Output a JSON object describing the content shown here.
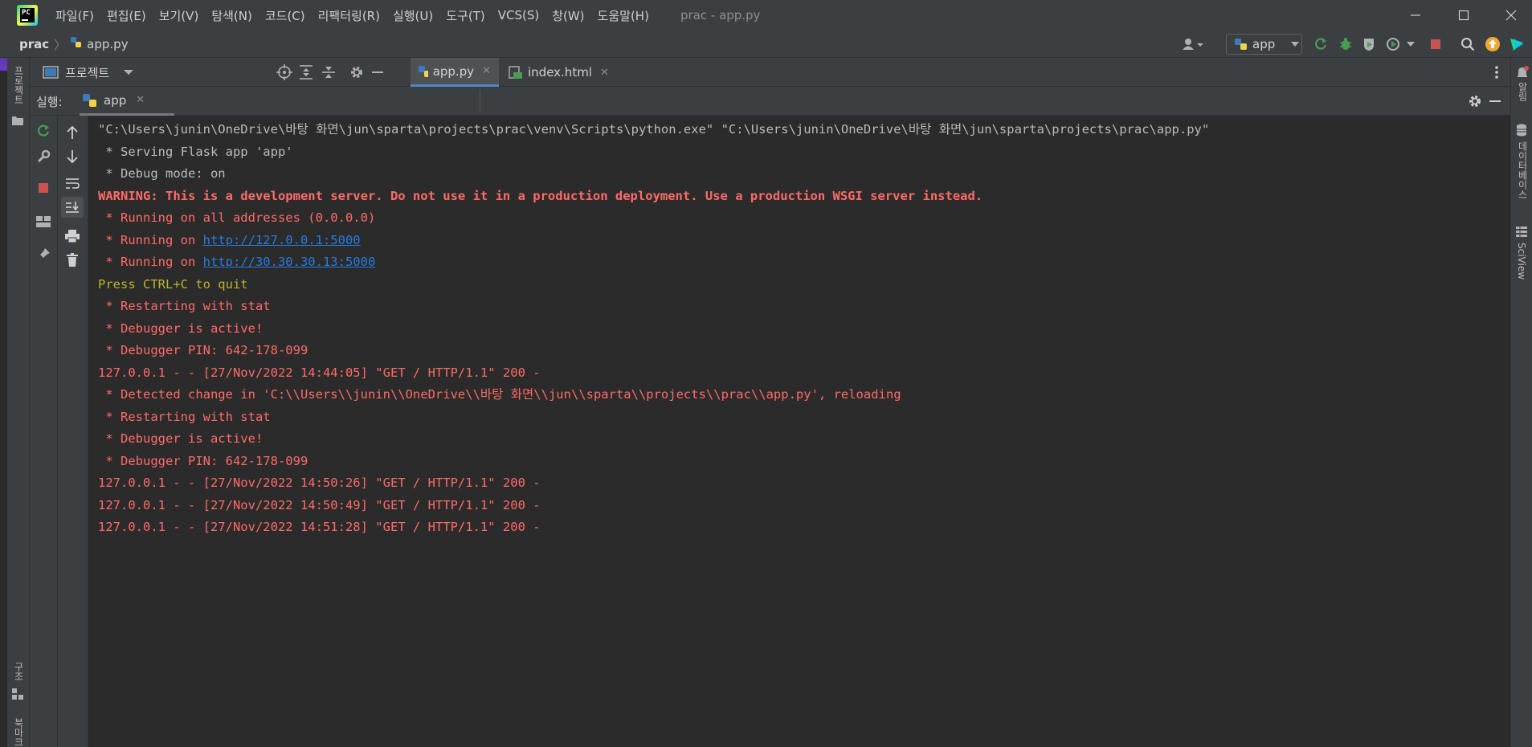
{
  "titlebar": {
    "menus": [
      "파일(F)",
      "편집(E)",
      "보기(V)",
      "탐색(N)",
      "코드(C)",
      "리팩터링(R)",
      "실행(U)",
      "도구(T)",
      "VCS(S)",
      "창(W)",
      "도움말(H)"
    ],
    "window_title": "prac - app.py",
    "logo_text": "PC"
  },
  "navbar": {
    "project": "prac",
    "file": "app.py",
    "run_config": "app"
  },
  "left_strip": {
    "project_label": "프로젝트",
    "structure_label": "구조",
    "bookmarks_label": "북마크"
  },
  "project_panel": {
    "label": "프로젝트"
  },
  "editor_tabs": [
    {
      "label": "app.py",
      "active": true
    },
    {
      "label": "index.html",
      "active": false
    }
  ],
  "run_panel": {
    "label": "실행:",
    "tab": "app"
  },
  "right_strip": {
    "notifications": "알림",
    "database": "데이터베이스",
    "sciview": "SciView"
  },
  "console": {
    "cmd": "\"C:\\Users\\junin\\OneDrive\\바탕 화면\\jun\\sparta\\projects\\prac\\venv\\Scripts\\python.exe\" \"C:\\Users\\junin\\OneDrive\\바탕 화면\\jun\\sparta\\projects\\prac\\app.py\"",
    "serving": " * Serving Flask app 'app'",
    "debug_mode": " * Debug mode: on",
    "warning": "WARNING: This is a development server. Do not use it in a production deployment. Use a production WSGI server instead.",
    "running_all": " * Running on all addresses (0.0.0.0)",
    "running_prefix": " * Running on ",
    "url_local": "http://127.0.0.1:5000",
    "url_lan": "http://30.30.30.13:5000",
    "quit": "Press CTRL+C to quit",
    "restart_1": " * Restarting with stat",
    "active_1": " * Debugger is active!",
    "pin_1": " * Debugger PIN: 642-178-099",
    "req_1": "127.0.0.1 - - [27/Nov/2022 14:44:05] \"GET / HTTP/1.1\" 200 -",
    "change": " * Detected change in 'C:\\\\Users\\\\junin\\\\OneDrive\\\\바탕 화면\\\\jun\\\\sparta\\\\projects\\\\prac\\\\app.py', reloading",
    "restart_2": " * Restarting with stat",
    "active_2": " * Debugger is active!",
    "pin_2": " * Debugger PIN: 642-178-099",
    "req_2": "127.0.0.1 - - [27/Nov/2022 14:50:26] \"GET / HTTP/1.1\" 200 -",
    "req_3": "127.0.0.1 - - [27/Nov/2022 14:50:49] \"GET / HTTP/1.1\" 200 -",
    "req_4": "127.0.0.1 - - [27/Nov/2022 14:51:28] \"GET / HTTP/1.1\" 200 -"
  },
  "colors": {
    "accent": "#4a88c7",
    "error": "#ff6b68",
    "link": "#287bde",
    "warning_yellow": "#bbb529",
    "run_green": "#499c54",
    "stop_red": "#c75450"
  }
}
